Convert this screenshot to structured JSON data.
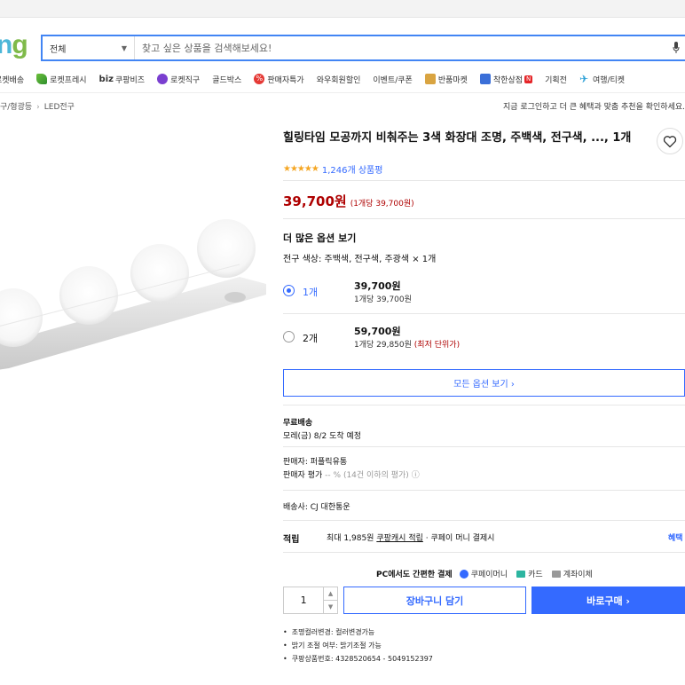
{
  "header": {
    "logo_text": "ng",
    "search": {
      "category": "전체",
      "placeholder": "찾고 싶은 상품을 검색해보세요!"
    }
  },
  "nav": {
    "items": [
      {
        "label": "로켓배송",
        "icon": "rocket-icon"
      },
      {
        "label": "로켓프레시",
        "icon": "rocket-fresh-icon"
      },
      {
        "biz": "biz",
        "label": "쿠팡비즈",
        "icon": "biz-logo"
      },
      {
        "label": "로켓직구",
        "icon": "globe-icon"
      },
      {
        "label": "골드박스",
        "icon": ""
      },
      {
        "label": "판매자특가",
        "icon": "percent-icon"
      },
      {
        "label": "와우회원할인",
        "icon": ""
      },
      {
        "label": "이벤트/쿠폰",
        "icon": ""
      },
      {
        "label": "반품마켓",
        "icon": "box-icon"
      },
      {
        "label": "착한상점",
        "icon": "store-icon",
        "badge": "N"
      },
      {
        "label": "기획전",
        "icon": ""
      },
      {
        "label": "여행/티켓",
        "icon": "plane-icon"
      }
    ]
  },
  "breadcrumb": [
    "구/형광등",
    "LED전구"
  ],
  "login_note": "지금 로그인하고 더 큰 혜택과 맞춤 추천을 확인하세요.",
  "product": {
    "title": "힐링타임 모공까지 비춰주는 3색 화장대 조명, 주백색, 전구색, ..., 1개",
    "rating_count": "1,246개 상품평",
    "price": "39,700원",
    "unit_price": "(1개당 39,700원)"
  },
  "options": {
    "heading": "더 많은 옵션 보기",
    "description": "전구 색상: 주백색, 전구색, 주광색 × 1개",
    "items": [
      {
        "qty": "1개",
        "price": "39,700원",
        "unit": "1개당 39,700원",
        "note": "",
        "selected": true
      },
      {
        "qty": "2개",
        "price": "59,700원",
        "unit": "1개당 29,850원",
        "note": "(최저 단위가)",
        "selected": false
      }
    ],
    "all_button": "모든 옵션 보기 ›"
  },
  "shipping": {
    "label": "무료배송",
    "date": "모레(금) 8/2 도착 예정",
    "seller": "판매자: 퍼플릭유통",
    "seller_rating_label": "판매자 평가",
    "seller_rating_value": "-- %",
    "seller_rating_note": "(14건 이하의 평가)",
    "carrier": "배송사: CJ 대한통운"
  },
  "reward": {
    "label": "적립",
    "prefix": "최대 1,985원",
    "link": "쿠팡캐시 적립",
    "suffix": "· 쿠페이 머니 결제시",
    "benefit": "혜택"
  },
  "payment": {
    "heading": "PC에서도 간편한 결제",
    "methods": [
      "쿠페이머니",
      "카드",
      "계좌이체"
    ]
  },
  "purchase": {
    "quantity": "1",
    "cart_label": "장바구니 담기",
    "buy_label": "바로구매 ›"
  },
  "details": [
    "조명컬러변경: 컬러변경가능",
    "밝기 조절 여부: 밝기조절 가능",
    "쿠팡상품번호: 4328520654 - 5049152397"
  ],
  "colors": {
    "accent": "#346aff",
    "price": "#ae0000",
    "search_border": "#4285f4",
    "star": "#f5a623"
  }
}
